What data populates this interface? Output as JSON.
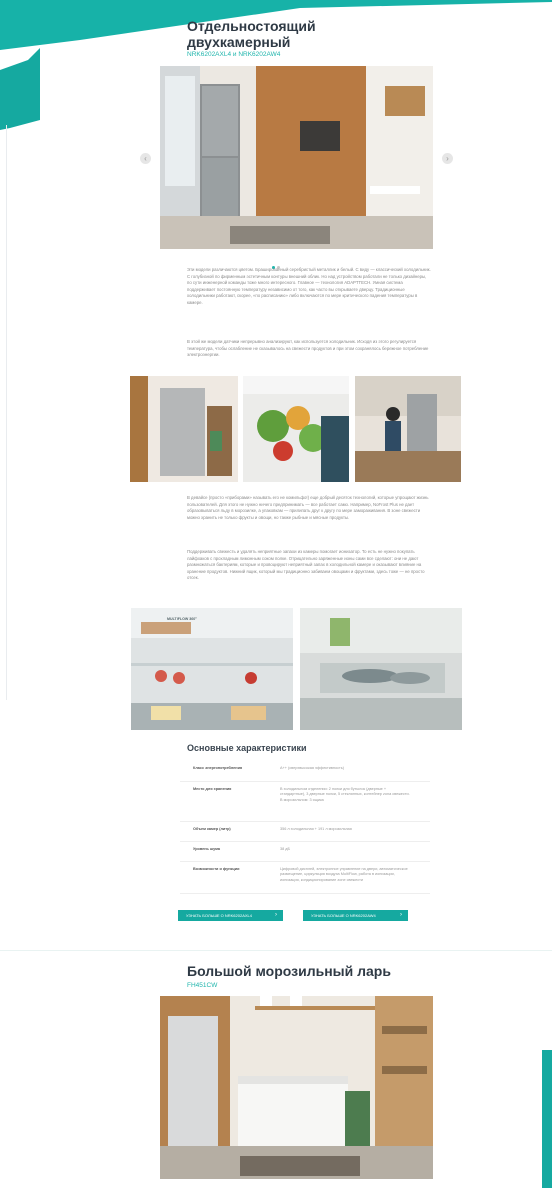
{
  "section1": {
    "title": "Отдельностоящий двухкамерный",
    "subtitle": "NRK6202AXL4 и NRK6202AW4",
    "paragraphs": [
      "Эти модели различаются цветом. Брашированный серебристый металлик и белый. С виду — классический холодильник. С голубизной по фирменным эстетичным контуры внешний облик. Но над устройством работали не только дизайнеры, по сути инженерной команды тоже много интересного. Главное — технология ADAPTTECH. Умная система поддерживает постоянную температуру независимо от того, как часто вы открываете дверцу. Традиционные холодильники работают, скорее, «по расписанию» либо включаются по мере критического падения температуры в камере.",
      "В этой же модели датчики непрерывно анализируют, как используется холодильник. Исходя из этого регулируется температура, чтобы ослабление не сказывалось на свежести продуктов и при этом сохранялось бережное потребление электроэнергии.",
      "В девайсе (просто «приборами» называть его не комильфо!) еще добрый десяток технологий, которые упрощают жизнь пользователей. Для этого не нужно ничего предпринимать — все работает само. Например, NoFrost Plus не дает образовываться льду в морозилке, а упаковкам — прилипать друг к другу по мере замораживания. В зоне свежести можно хранить не только фрукты и овощи, но также рыбные и мясные продукты.",
      "Поддерживать свежесть и удалять неприятные запахи из камеры помогает ионизатор. То есть не нужно покупать лайфхаков с прохладным лимонным соком полке. Отрицательно заряженные ионы сами все сделают: они не дают размножаться бактериям, которые и провоцируют неприятный запах в холодильной камере и оказывают влияние на хранение продуктов. Нижний ящик, который мы традиционно забиваем овощами и фруктами, здесь тоже — не просто отсек."
    ]
  },
  "carousel": {
    "prev_label": "‹",
    "next_label": "›"
  },
  "specs": {
    "title": "Основные характеристики",
    "rows": [
      {
        "label": "Класс энергопотребления",
        "value": "A++ (сверхвысокая эффективность)"
      },
      {
        "label": "Место для хранения",
        "value": "В холодильном отделении: 2 полки для бутылок (дверные + стандартные), 3 дверные полки, 5 стеклянных, контейнер zona свежести. В морозильном: 3 ящика"
      },
      {
        "label": "Объем камер (литр)",
        "value": "356 л холодильная + 191 л морозильная"
      },
      {
        "label": "Уровень шума",
        "value": "38 дБ"
      },
      {
        "label": "Возможности и функции",
        "value": "Цифровой дисплей, электронное управление на двери, автоматическое размещение, циркуляция воздуха MultiFlow, работа в ионизации, ионизация, кондиционирование zone свежести"
      }
    ]
  },
  "buttons": {
    "more1": "УЗНАТЬ БОЛЬШЕ О NRK6202AXL4",
    "more2": "УЗНАТЬ БОЛЬШЕ О NRK6202AW4",
    "chevron": "›"
  },
  "section2": {
    "title": "Большой морозильный ларь",
    "subtitle": "FH451CW"
  },
  "photo_labels": {
    "multiflow": "MULTIFLOW 360°"
  },
  "colors": {
    "accent": "#1fb5ac",
    "button": "#15a9a0",
    "heading": "#2f3a45"
  }
}
